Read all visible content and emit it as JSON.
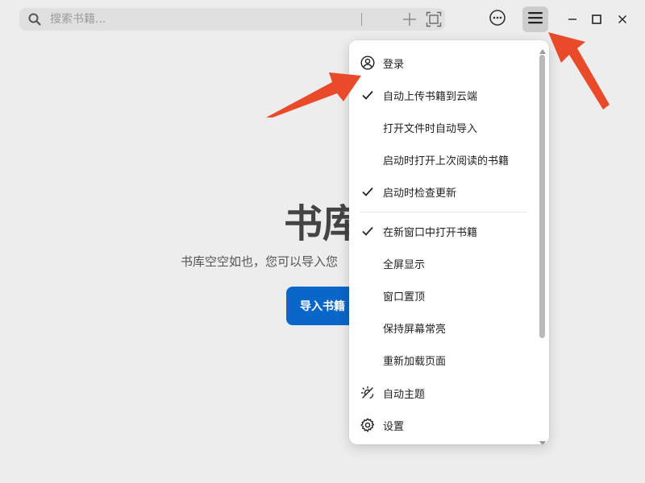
{
  "search": {
    "placeholder": "搜索书籍..."
  },
  "toolbar": {
    "add_icon": "plus-icon",
    "scan_icon": "scan-frame-icon",
    "more_icon": "more-circle-icon",
    "menu_icon": "hamburger-icon"
  },
  "window_controls": [
    "minimize-icon",
    "maximize-icon",
    "close-icon"
  ],
  "library": {
    "title": "书库",
    "empty_text": "书库空空如也，您可以导入您",
    "import_button": "导入书籍"
  },
  "menu": {
    "items": [
      {
        "label": "登录",
        "icon": "user-circle-icon",
        "checked": false
      },
      {
        "label": "自动上传书籍到云端",
        "icon": "check-icon",
        "checked": true
      },
      {
        "label": "打开文件时自动导入",
        "icon": "",
        "checked": false
      },
      {
        "label": "启动时打开上次阅读的书籍",
        "icon": "",
        "checked": false
      },
      {
        "label": "启动时检查更新",
        "icon": "check-icon",
        "checked": true
      },
      {
        "label": "在新窗口中打开书籍",
        "icon": "check-icon",
        "checked": true
      },
      {
        "label": "全屏显示",
        "icon": "",
        "checked": false
      },
      {
        "label": "窗口置顶",
        "icon": "",
        "checked": false
      },
      {
        "label": "保持屏幕常亮",
        "icon": "",
        "checked": false
      },
      {
        "label": "重新加载页面",
        "icon": "",
        "checked": false
      },
      {
        "label": "自动主题",
        "icon": "auto-theme-icon",
        "checked": false
      },
      {
        "label": "设置",
        "icon": "gear-icon",
        "checked": false
      }
    ]
  },
  "colors": {
    "background": "#ededed",
    "accent": "#0a66c8",
    "annotation_arrow": "#e84a2a"
  }
}
